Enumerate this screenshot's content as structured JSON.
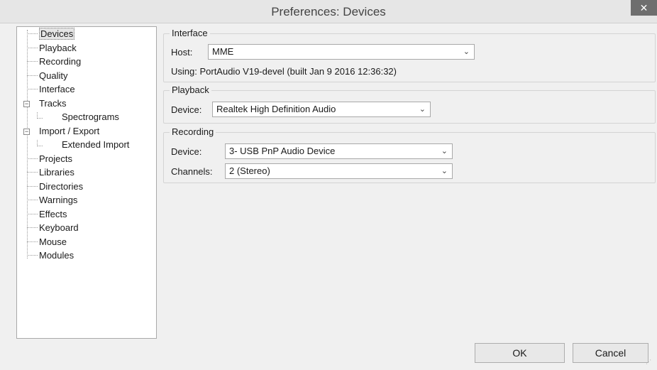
{
  "window": {
    "title": "Preferences: Devices",
    "close_glyph": "✕"
  },
  "tree": {
    "items": [
      {
        "label": "Devices",
        "selected": true
      },
      {
        "label": "Playback"
      },
      {
        "label": "Recording"
      },
      {
        "label": "Quality"
      },
      {
        "label": "Interface"
      },
      {
        "label": "Tracks",
        "expander": "−"
      },
      {
        "label": "Spectrograms"
      },
      {
        "label": "Import / Export",
        "expander": "−"
      },
      {
        "label": "Extended Import"
      },
      {
        "label": "Projects"
      },
      {
        "label": "Libraries"
      },
      {
        "label": "Directories"
      },
      {
        "label": "Warnings"
      },
      {
        "label": "Effects"
      },
      {
        "label": "Keyboard"
      },
      {
        "label": "Mouse"
      },
      {
        "label": "Modules"
      }
    ]
  },
  "interface": {
    "title": "Interface",
    "host_label": "Host:",
    "host_value": "MME",
    "using_text": "Using: PortAudio V19-devel (built Jan  9 2016 12:36:32)"
  },
  "playback": {
    "title": "Playback",
    "device_label": "Device:",
    "device_value": "Realtek High Definition Audio"
  },
  "recording": {
    "title": "Recording",
    "device_label": "Device:",
    "device_value": "3- USB PnP Audio Device",
    "channels_label": "Channels:",
    "channels_value": "2 (Stereo)"
  },
  "buttons": {
    "ok": "OK",
    "cancel": "Cancel"
  },
  "icons": {
    "chevron": "⌄",
    "grip": "⋰"
  }
}
